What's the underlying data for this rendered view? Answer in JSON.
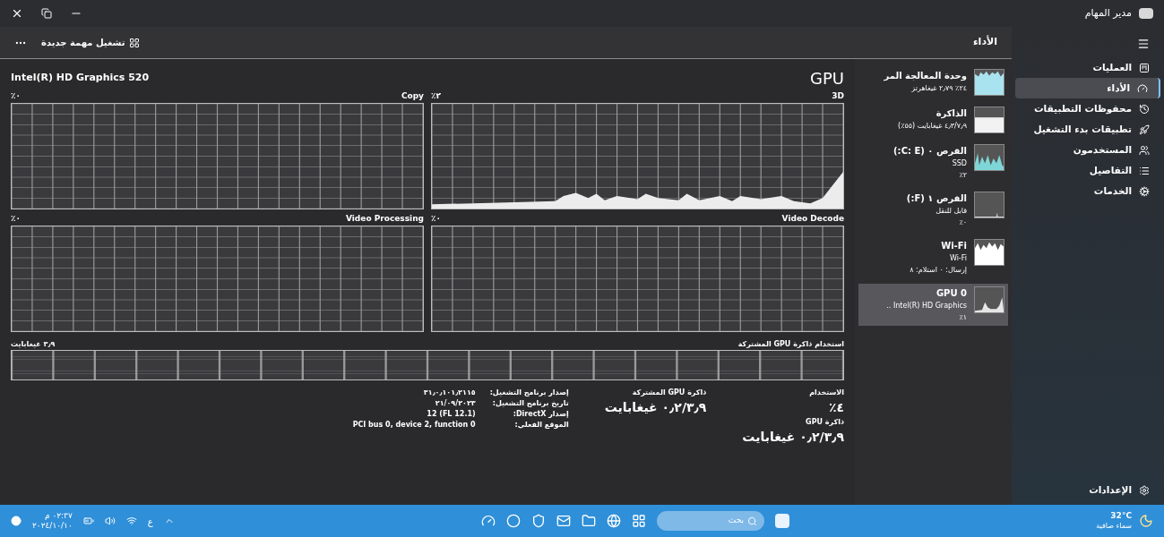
{
  "window": {
    "title": "مدير المهام"
  },
  "toolbar": {
    "run_task": "تشغيل مهمة جديدة"
  },
  "section_title": "الأداء",
  "nav": {
    "items": [
      {
        "label": "العمليات",
        "selected": false
      },
      {
        "label": "الأداء",
        "selected": true
      },
      {
        "label": "محفوظات التطبيقات",
        "selected": false
      },
      {
        "label": "تطبيقات بدء التشغيل",
        "selected": false
      },
      {
        "label": "المستخدمون",
        "selected": false
      },
      {
        "label": "التفاصيل",
        "selected": false
      },
      {
        "label": "الخدمات",
        "selected": false
      }
    ],
    "settings": "الإعدادات"
  },
  "devices": [
    {
      "name": "وحدة المعالجة المر",
      "lines": [
        "٢٤٪ ٢٫٧٩ غيغاهرتز"
      ],
      "selected": false
    },
    {
      "name": "الذاكرة",
      "lines": [
        "٤٫٣/٧٫٩ غيغابايت (٥٥٪)"
      ],
      "selected": false
    },
    {
      "name": "القرص ٠ (C: E:)",
      "lines": [
        "SSD",
        "٢٪"
      ],
      "selected": false
    },
    {
      "name": "القرص ١ (F:)",
      "lines": [
        "قابل للنقل",
        "٠٪"
      ],
      "selected": false
    },
    {
      "name": "Wi-Fi",
      "lines": [
        "Wi-Fi",
        "إرسال: ٠ استلام: ٨"
      ],
      "selected": false
    },
    {
      "name": "GPU 0",
      "lines": [
        "Intel(R) HD Graphics ..",
        "١٪"
      ],
      "selected": true
    }
  ],
  "gpu": {
    "title": "GPU",
    "model": "Intel(R) HD Graphics 520",
    "engines": [
      {
        "name": "3D",
        "reading": "٢٪"
      },
      {
        "name": "Copy",
        "reading": "٠٪"
      },
      {
        "name": "Video Decode",
        "reading": "٠٪"
      },
      {
        "name": "Video Processing",
        "reading": "٠٪"
      }
    ],
    "shared_memory": {
      "label": "استخدام ذاكرة GPU المشتركة",
      "reading": "٣٫٩ غيغابايت"
    },
    "stats": [
      {
        "label": "الاستخدام",
        "value": "٤٪"
      },
      {
        "label": "ذاكرة GPU",
        "value": "٠٫٢/٣٫٩ غيغابايت"
      }
    ],
    "shared_stat": {
      "label": "ذاكرة GPU المشتركة",
      "value": "٠٫٢/٣٫٩ غيغابايت"
    },
    "details": [
      {
        "label": "إصدار برنامج التشغيل:",
        "value": "٣١٫٠٫١٠١٫٢١١٥"
      },
      {
        "label": "تاريخ برنامج التشغيل:",
        "value": "٢١/٠٩/٢٠٢٣"
      },
      {
        "label": "إصدار DirectX:",
        "value": "12 (FL 12.1)"
      },
      {
        "label": "الموقع الفعلي:",
        "value": "PCI bus 0, device 2, function 0"
      }
    ]
  },
  "taskbar": {
    "temperature": "32°C",
    "weather": "سماء صافية",
    "search_placeholder": "بحث",
    "language": "ع",
    "time": "٠٢:٣٧ م",
    "date": "٢٠٢٤/١٠/١٠"
  }
}
